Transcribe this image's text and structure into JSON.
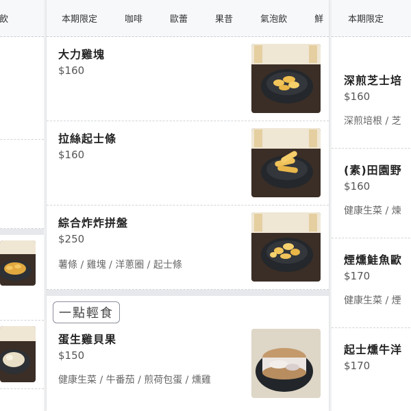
{
  "left": {
    "tabs": [
      "泡飲"
    ]
  },
  "middle": {
    "tabs": [
      "本期限定",
      "咖啡",
      "歐蕾",
      "果昔",
      "氣泡飲",
      "鮮"
    ],
    "items": [
      {
        "name": "大力雞塊",
        "price": "$160",
        "desc": ""
      },
      {
        "name": "拉絲起士條",
        "price": "$160",
        "desc": ""
      },
      {
        "name": "綜合炸炸拼盤",
        "price": "$250",
        "desc": "薯條 / 雞塊 / 洋蔥圈 / 起士條"
      }
    ],
    "section": "一點輕食",
    "section_items": [
      {
        "name": "蛋生雞貝果",
        "price": "$150",
        "desc": "健康生菜 / 牛番茄 / 煎荷包蛋 / 燻雞"
      }
    ]
  },
  "right": {
    "tabs": [
      "本期限定"
    ],
    "items": [
      {
        "name": "深煎芝士培",
        "price": "$160",
        "desc": "深煎培根 / 芝"
      },
      {
        "name": "(素)田園野",
        "price": "$160",
        "desc": "健康生菜 / 煉"
      },
      {
        "name": "煙燻鮭魚歐",
        "price": "$170",
        "desc": "健康生菜 / 煙"
      },
      {
        "name": "起士燻牛洋",
        "price": "$170",
        "desc": ""
      }
    ]
  },
  "colors": {
    "tabbar_bg": "#f7f8fa",
    "section_gap": "#e6e8ec",
    "food_table": "#3a2e26",
    "food_wall": "#efe6d4"
  },
  "icons": [
    "food-photo-nuggets",
    "food-photo-cheese-sticks",
    "food-photo-fried-platter",
    "food-photo-bagel"
  ]
}
